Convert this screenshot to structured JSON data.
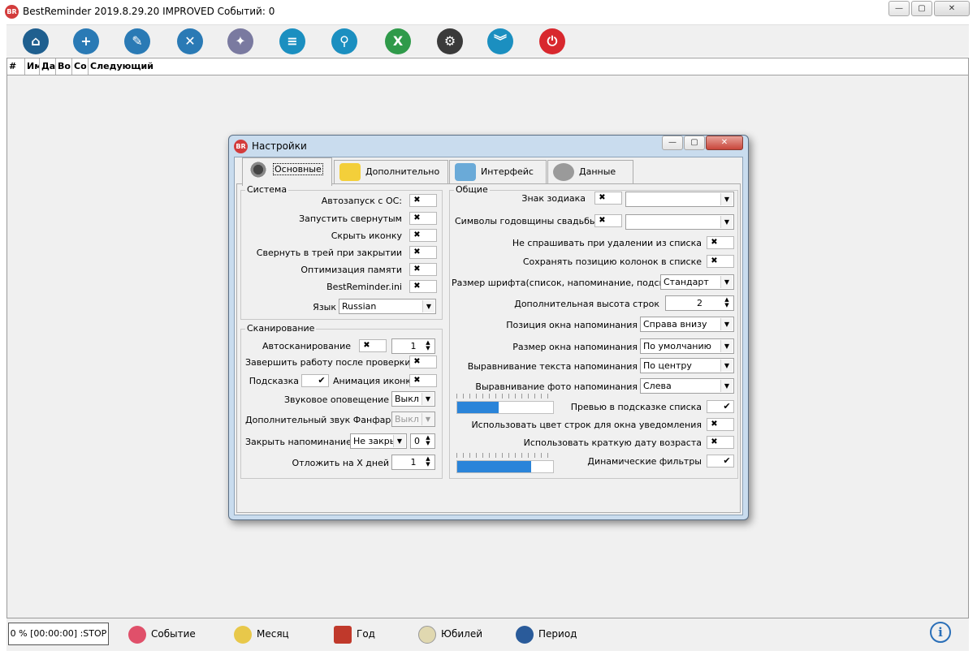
{
  "window": {
    "logo": "BR",
    "title": "BestReminder 2019.8.29.20 IMPROVED  Событий: 0",
    "buttons": {
      "minimize": "—",
      "maximize": "▢",
      "close": "✕"
    }
  },
  "toolbar": {
    "buttons": [
      {
        "name": "home",
        "icon": "home-icon",
        "glyph": "⌂",
        "color": "#1f5f8f"
      },
      {
        "name": "add-event",
        "icon": "add-event-icon",
        "glyph": "+",
        "color": "#2a7ab5"
      },
      {
        "name": "edit-event",
        "icon": "edit-event-icon",
        "glyph": "✎",
        "color": "#2a7ab5"
      },
      {
        "name": "delete-event",
        "icon": "delete-event-icon",
        "glyph": "✕",
        "color": "#2a7ab5"
      },
      {
        "name": "themes",
        "icon": "palette-icon",
        "glyph": "✦",
        "color": "#7a7aa0"
      },
      {
        "name": "layers",
        "icon": "layers-icon",
        "glyph": "≡",
        "color": "#1b8fc0"
      },
      {
        "name": "search",
        "icon": "search-icon",
        "glyph": "⚲",
        "color": "#1b8fc0"
      },
      {
        "name": "excel-export",
        "icon": "excel-icon",
        "glyph": "X",
        "color": "#2f9a4a"
      },
      {
        "name": "settings",
        "icon": "gear-icon",
        "glyph": "⚙",
        "color": "#3a3a3a"
      },
      {
        "name": "collapse",
        "icon": "double-chevron-down-icon",
        "glyph": "︾",
        "color": "#1b8fc0"
      },
      {
        "name": "power-off",
        "icon": "power-icon",
        "glyph": "⏻",
        "color": "#d8282e"
      }
    ]
  },
  "grid": {
    "columns": [
      "#",
      "Им",
      "Да",
      "Во",
      "Со",
      "Следующий"
    ]
  },
  "statusbar": {
    "status": "0 % [00:00:00] :STOP",
    "items": [
      {
        "label": "Событие",
        "icon": "balloon-icon",
        "color": "#e0506a"
      },
      {
        "label": "Месяц",
        "icon": "moon-icon",
        "color": "#e8c84a"
      },
      {
        "label": "Год",
        "icon": "calendar-icon",
        "color": "#c0392b"
      },
      {
        "label": "Юбилей",
        "icon": "clock-face-icon",
        "color": "#e0d8b0"
      },
      {
        "label": "Период",
        "icon": "clock-icon",
        "color": "#2a5b9a"
      }
    ],
    "info_glyph": "i"
  },
  "dialog": {
    "title": "Настройки",
    "tabs": [
      "Основные",
      "Дополнительно",
      "Интерфейс",
      "Данные"
    ],
    "system": {
      "title": "Система",
      "autostart": "Автозапуск с ОС:",
      "start_minimized": "Запустить свернутым",
      "hide_icon": "Скрыть иконку",
      "minimize_to_tray": "Свернуть в трей при закрытии",
      "memory_opt": "Оптимизация памяти",
      "ini": "BestReminder.ini",
      "language_label": "Язык",
      "language": "Russian"
    },
    "scan": {
      "title": "Сканирование",
      "autoscan": "Автосканирование",
      "autoscan_value": "1",
      "finish_after_check": "Завершить работу после проверки",
      "hint": "Подсказка",
      "icon_animation": "Анимация иконки",
      "sound_label": "Звуковое оповещение",
      "sound": "Выкл",
      "fanfare_label": "Дополнительный звук Фанфар",
      "fanfare": "Выкл",
      "close_label": "Закрыть напоминание",
      "close_value": "Не закры",
      "close_num": "0",
      "postpone_label": "Отложить на Х дней",
      "postpone_value": "1"
    },
    "general": {
      "title": "Общие",
      "zodiac": "Знак зодиака",
      "wedding": "Символы годовщины свадьбы",
      "no_ask_delete": "Не спрашивать при удалении из списка",
      "save_columns": "Сохранять позицию колонок в списке",
      "font_size_label": "Размер шрифта(список, напоминание, подсказки)",
      "font_size": "Стандарт",
      "row_height_label": "Дополнительная высота строк",
      "row_height": "2",
      "position_label": "Позиция окна напоминания",
      "position": "Справа внизу",
      "win_size_label": "Размер окна напоминания",
      "win_size": "По умолчанию",
      "text_align_label": "Выравнивание текста напоминания",
      "text_align": "По центру",
      "photo_align_label": "Выравнивание фото напоминания",
      "photo_align": "Слева",
      "preview": "Превью в подсказке списка",
      "row_color": "Использовать цвет строк для окна уведомления",
      "short_date": "Использовать краткую дату возраста",
      "dynamic_filters": "Динамические фильтры",
      "slider1": 0.43,
      "slider2": 0.77
    },
    "checks": {
      "mark_x": "✖",
      "mark_v": "✔"
    },
    "arrows": {
      "down": "▼",
      "up": "▲"
    }
  }
}
